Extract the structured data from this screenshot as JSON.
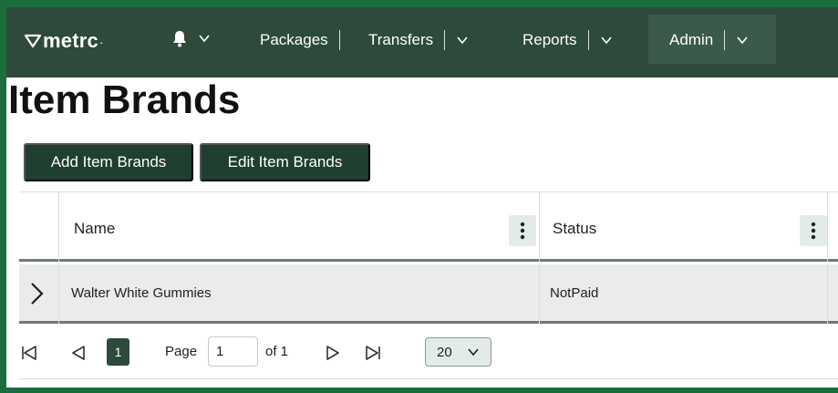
{
  "nav": {
    "logo": "metrc",
    "items": [
      {
        "label": "Packages"
      },
      {
        "label": "Transfers"
      },
      {
        "label": "Reports"
      },
      {
        "label": "Admin"
      }
    ]
  },
  "page": {
    "title": "Item Brands"
  },
  "toolbar": {
    "add_label": "Add Item Brands",
    "edit_label": "Edit Item Brands"
  },
  "grid": {
    "columns": [
      {
        "label": "Name"
      },
      {
        "label": "Status"
      }
    ],
    "rows": [
      {
        "name": "Walter White Gummies",
        "status": "NotPaid"
      }
    ]
  },
  "pager": {
    "current_page": "1",
    "page_label": "Page",
    "page_input_value": "1",
    "of_label": "of 1",
    "page_size": "20"
  },
  "colors": {
    "frame": "#1b6e3c",
    "nav_bg": "#2d4a3a",
    "button_bg": "#1f3f30"
  }
}
